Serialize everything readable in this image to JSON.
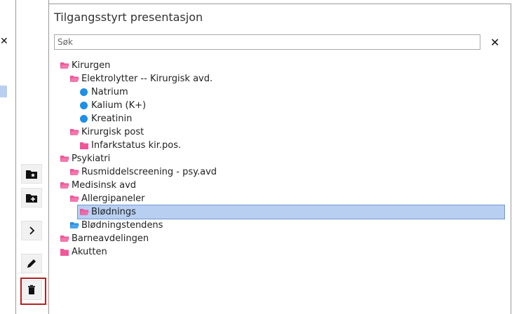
{
  "panel": {
    "title": "Tilgangsstyrt presentasjon",
    "search_placeholder": "Søk",
    "clear_symbol": "✕"
  },
  "left_panel": {
    "close_symbol": "✕"
  },
  "toolbar": [
    {
      "name": "add-folder-star-button",
      "icon": "folder-star-icon"
    },
    {
      "name": "add-folder-button",
      "icon": "folder-plus-icon"
    },
    {
      "name": "expand-button",
      "icon": "chevron-right-icon"
    },
    {
      "name": "edit-button",
      "icon": "pencil-icon"
    },
    {
      "name": "delete-button",
      "icon": "trash-icon"
    }
  ],
  "colors": {
    "folder_pink": "#f0569a",
    "folder_blue": "#1e8fe6",
    "dot_blue": "#1e8fe6",
    "selected_bg": "#b9cff2",
    "highlight_red": "#b22222"
  },
  "tree": [
    {
      "label": "Kirurgen",
      "icon": "folder-open-icon",
      "color": "pink",
      "level": 0
    },
    {
      "label": "Elektrolytter -- Kirurgisk avd.",
      "icon": "folder-open-icon",
      "color": "pink",
      "level": 1
    },
    {
      "label": "Natrium",
      "icon": "dot-icon",
      "color": "blue",
      "level": 2
    },
    {
      "label": "Kalium (K+)",
      "icon": "dot-icon",
      "color": "blue",
      "level": 2
    },
    {
      "label": "Kreatinin",
      "icon": "dot-icon",
      "color": "blue",
      "level": 2
    },
    {
      "label": "Kirurgisk post",
      "icon": "folder-open-icon",
      "color": "pink",
      "level": 1
    },
    {
      "label": "Infarkstatus kir.pos.",
      "icon": "folder-closed-icon",
      "color": "pink",
      "level": 2
    },
    {
      "label": "Psykiatri",
      "icon": "folder-open-icon",
      "color": "pink",
      "level": 0
    },
    {
      "label": "Rusmiddelscreening - psy.avd",
      "icon": "folder-open-icon",
      "color": "pink",
      "level": 1
    },
    {
      "label": "Medisinsk avd",
      "icon": "folder-open-icon",
      "color": "pink",
      "level": 0
    },
    {
      "label": "Allergipaneler",
      "icon": "folder-open-icon",
      "color": "pink",
      "level": 1
    },
    {
      "label": "Blødnings",
      "icon": "folder-open-icon",
      "color": "pink",
      "level": 2,
      "selected": true
    },
    {
      "label": "Blødningstendens",
      "icon": "folder-open-icon",
      "color": "blue",
      "level": 1
    },
    {
      "label": "Barneavdelingen",
      "icon": "folder-open-icon",
      "color": "pink",
      "level": 0
    },
    {
      "label": "Akutten",
      "icon": "folder-closed-icon",
      "color": "pink",
      "level": 0
    }
  ]
}
